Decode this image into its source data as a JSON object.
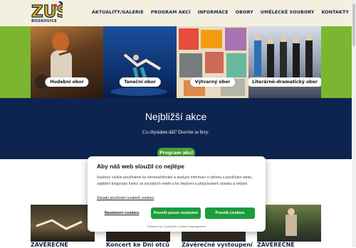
{
  "header": {
    "logo_text": "ZUŠ",
    "logo_sub": "BOSKOVICE",
    "nav": [
      "AKTUALITY/GALERIE",
      "PROGRAM AKCÍ",
      "INFORMACE",
      "OBORY",
      "UMĚLECKÉ SOUBORY",
      "KONTAKTY"
    ]
  },
  "obory": [
    "Hudební obor",
    "Taneční obor",
    "Výtvarný obor",
    "Literárně-dramatický obor"
  ],
  "events": {
    "title": "Nejbližší akce",
    "subtitle": "Co chystáme dál? Dozvíte se brzy.",
    "button": "Program akcí"
  },
  "cards": [
    "ZÁVĚREČNÉ",
    "Koncert ke Dni otců",
    "Závěrečné vystoupení",
    "ZÁVĚREČNÉ"
  ],
  "cookie": {
    "title": "Aby náš web sloužil co nejlépe",
    "text": "Soubory cookie používáme ke shromažďování a analýze informací o výkonu a používání webu, zajištění fungování funkcí ze sociálních médií a ke zlepšení a přizpůsobení obsahu a reklam.",
    "link": "Zásady používání souborů cookies",
    "btn_settings": "Nastavení cookies",
    "btn_necessary": "Povolit pouze nezbytné",
    "btn_all": "Povolit cookies",
    "powered": "Powered by Cookiehub Consent Management"
  },
  "colors": {
    "navy": "#0e2450",
    "green": "#7cb631",
    "button_green": "#4aa33a",
    "cream": "#f4f0e0"
  }
}
